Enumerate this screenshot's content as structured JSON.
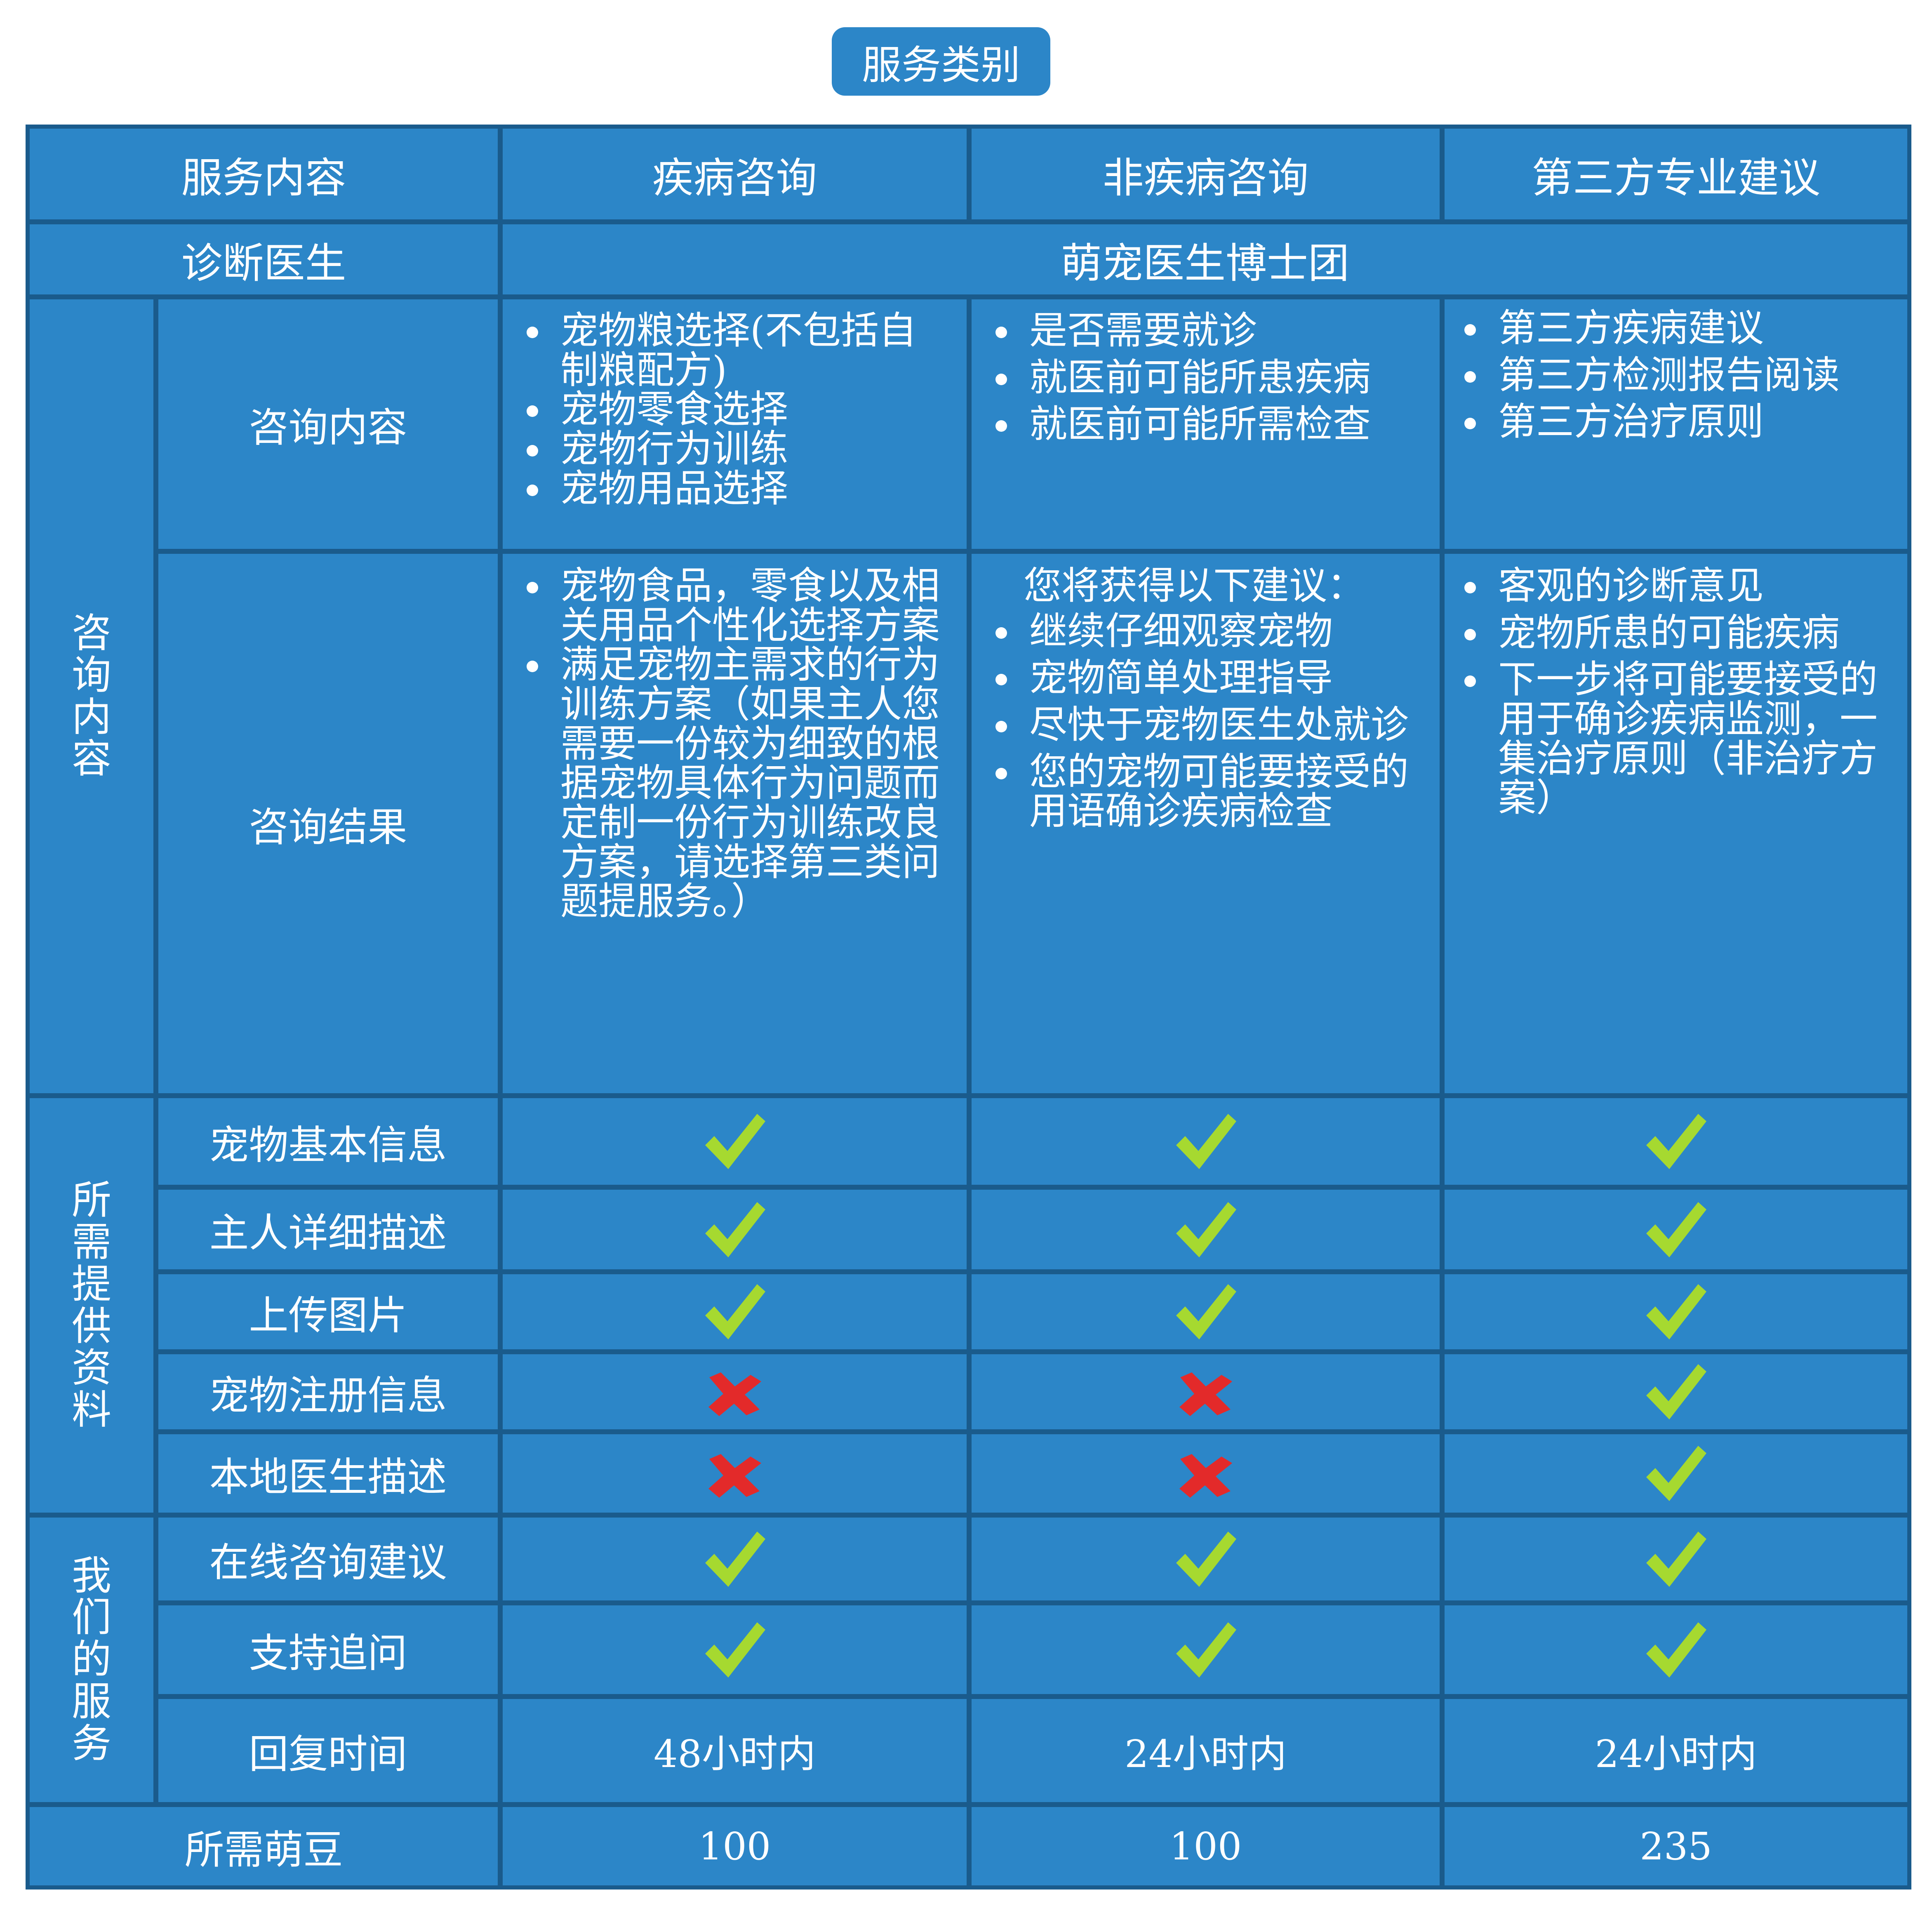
{
  "title": "服务类别",
  "header": {
    "col0": "服务内容",
    "col1": "疾病咨询",
    "col2": "非疾病咨询",
    "col3": "第三方专业建议"
  },
  "doctor": {
    "label": "诊断医生",
    "value": "萌宠医生博士团"
  },
  "groups": {
    "consult": [
      "咨",
      "询",
      "内",
      "容"
    ],
    "materials": [
      "所",
      "需",
      "提",
      "供",
      "资",
      "料"
    ],
    "services": [
      "我",
      "们",
      "的",
      "服",
      "务"
    ]
  },
  "consult_content": {
    "label": "咨询内容",
    "col1": [
      "宠物粮选择(不包括自制粮配方)",
      "宠物零食选择",
      "宠物行为训练",
      "宠物用品选择"
    ],
    "col2": [
      "是否需要就诊",
      "就医前可能所患疾病",
      "就医前可能所需检查"
    ],
    "col3": [
      "第三方疾病建议",
      "第三方检测报告阅读",
      "第三方治疗原则"
    ]
  },
  "consult_result": {
    "label": "咨询结果",
    "col1": [
      "宠物食品，零食以及相关用品个性化选择方案",
      "满足宠物主需求的行为训练方案（如果主人您需要一份较为细致的根据宠物具体行为问题而定制一份行为训练改良方案，请选择第三类问题提服务。）"
    ],
    "col2_intro": "您将获得以下建议：",
    "col2": [
      "继续仔细观察宠物",
      "宠物简单处理指导",
      "尽快于宠物医生处就诊",
      "您的宠物可能要接受的用语确诊疾病检查"
    ],
    "col3": [
      "客观的诊断意见",
      "宠物所患的可能疾病",
      "下一步将可能要接受的用于确诊疾病监测，一集治疗原则（非治疗方案）"
    ]
  },
  "materials": [
    {
      "label": "宠物基本信息",
      "values": [
        "check",
        "check",
        "check"
      ]
    },
    {
      "label": "主人详细描述",
      "values": [
        "check",
        "check",
        "check"
      ]
    },
    {
      "label": "上传图片",
      "values": [
        "check",
        "check",
        "check"
      ]
    },
    {
      "label": "宠物注册信息",
      "values": [
        "cross",
        "cross",
        "check"
      ]
    },
    {
      "label": "本地医生描述",
      "values": [
        "cross",
        "cross",
        "check"
      ]
    }
  ],
  "services": [
    {
      "label": "在线咨询建议",
      "values": [
        "check",
        "check",
        "check"
      ]
    },
    {
      "label": "支持追问",
      "values": [
        "check",
        "check",
        "check"
      ]
    }
  ],
  "reply_time": {
    "label": "回复时间",
    "values": [
      "48小时内",
      "24小时内",
      "24小时内"
    ]
  },
  "beans": {
    "label": "所需萌豆",
    "values": [
      "100",
      "100",
      "235"
    ]
  },
  "colors": {
    "cell": "#2c86c8",
    "border": "#1a5b8c",
    "check": "#a6d930",
    "cross": "#e32a2a"
  },
  "icons": {
    "check": "check-icon",
    "cross": "cross-icon"
  }
}
